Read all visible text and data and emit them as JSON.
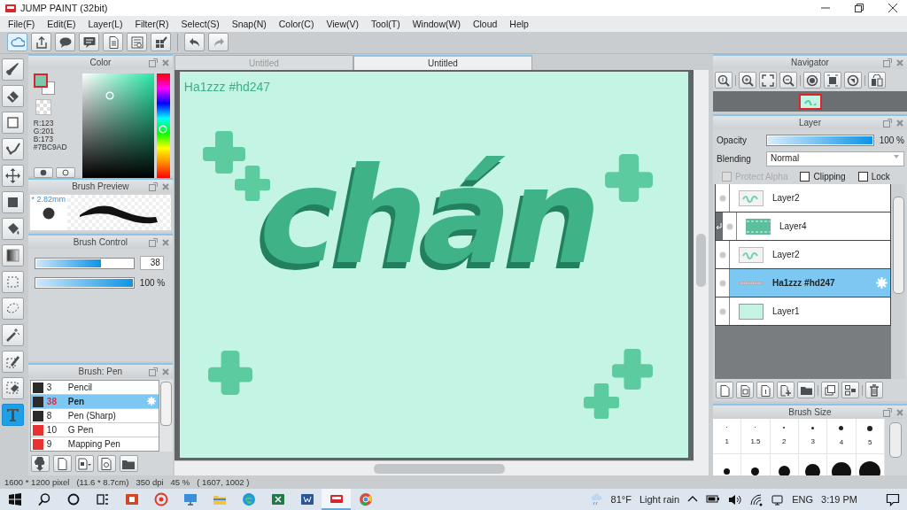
{
  "window": {
    "title": "JUMP PAINT (32bit)"
  },
  "menu": [
    "File(F)",
    "Edit(E)",
    "Layer(L)",
    "Filter(R)",
    "Select(S)",
    "Snap(N)",
    "Color(C)",
    "View(V)",
    "Tool(T)",
    "Window(W)",
    "Cloud",
    "Help"
  ],
  "tools": [
    {
      "kind": "brush",
      "selected": false
    },
    {
      "kind": "eraser",
      "selected": false
    },
    {
      "kind": "shape",
      "selected": false
    },
    {
      "kind": "curve",
      "selected": false
    },
    {
      "kind": "move",
      "selected": false
    },
    {
      "kind": "fill",
      "selected": false
    },
    {
      "kind": "bucket",
      "selected": false
    },
    {
      "kind": "gradient",
      "selected": false
    },
    {
      "kind": "marquee",
      "selected": false
    },
    {
      "kind": "lasso",
      "selected": false
    },
    {
      "kind": "wand",
      "selected": false
    },
    {
      "kind": "select_pen",
      "selected": false
    },
    {
      "kind": "select_eraser",
      "selected": false
    },
    {
      "kind": "text",
      "selected": true
    }
  ],
  "color_panel": {
    "title": "Color",
    "r": "R:123",
    "g": "G:201",
    "b": "B:173",
    "hex": "#7BC9AD"
  },
  "brush_preview": {
    "title": "Brush Preview",
    "size": "* 2.82mm"
  },
  "brush_control": {
    "title": "Brush Control",
    "sliders": [
      {
        "level": 0.67,
        "reading": "38"
      },
      {
        "level": 1.0,
        "reading": "100 %"
      }
    ]
  },
  "brush_list": {
    "title": "Brush: Pen",
    "items": [
      {
        "color": "#2b2b2b",
        "size": "3",
        "name": "Pencil",
        "selected": false
      },
      {
        "color": "#2b2b2b",
        "size": "38",
        "name": "Pen",
        "selected": true
      },
      {
        "color": "#2b2b2b",
        "size": "8",
        "name": "Pen (Sharp)",
        "selected": false
      },
      {
        "color": "#e83232",
        "size": "10",
        "name": "G Pen",
        "selected": false
      },
      {
        "color": "#e83232",
        "size": "9",
        "name": "Mapping Pen",
        "selected": false
      }
    ]
  },
  "canvas": {
    "tabs": [
      {
        "label": "Untitled",
        "selected": false
      },
      {
        "label": "Untitled",
        "selected": true
      }
    ],
    "caption": "Ha1zzz #hd247",
    "lettering": "chán"
  },
  "navigator": {
    "title": "Navigator"
  },
  "layer_panel": {
    "title": "Layer",
    "opacity": {
      "label": "Opacity",
      "level": 1.0,
      "reading": "100 %"
    },
    "blending": {
      "label": "Blending",
      "value": "Normal"
    },
    "options": [
      {
        "label": "Protect Alpha",
        "checked": false,
        "disabled": true
      },
      {
        "label": "Clipping",
        "checked": false,
        "disabled": false
      },
      {
        "label": "Lock",
        "checked": false,
        "disabled": false
      }
    ],
    "layers": [
      {
        "name": "Layer2",
        "kind": "lettering",
        "clipped": false,
        "selected": false
      },
      {
        "name": "Layer4",
        "kind": "fill",
        "clipped": true,
        "selected": false
      },
      {
        "name": "Layer2",
        "kind": "lettering",
        "clipped": false,
        "selected": false
      },
      {
        "name": "Ha1zzz #hd247",
        "kind": "text",
        "clipped": false,
        "selected": true
      },
      {
        "name": "Layer1",
        "kind": "background",
        "clipped": false,
        "selected": false
      }
    ]
  },
  "brush_size": {
    "title": "Brush Size",
    "sizes": [
      "1",
      "1.5",
      "2",
      "3",
      "4",
      "5"
    ]
  },
  "status_bar": {
    "pixels": "1600 * 1200 pixel",
    "physical": "(11.6 * 8.7cm)",
    "dpi": "350 dpi",
    "zoom": "45 %",
    "cursor": "( 1607, 1002 )"
  },
  "taskbar": {
    "apps": [
      {
        "kind": "slides",
        "selected": false
      },
      {
        "kind": "recorder",
        "selected": false
      },
      {
        "kind": "monitor",
        "selected": false
      },
      {
        "kind": "folder",
        "selected": false
      },
      {
        "kind": "browser",
        "selected": false
      },
      {
        "kind": "sheet",
        "selected": false
      },
      {
        "kind": "doc",
        "selected": false
      },
      {
        "kind": "paint",
        "selected": true
      },
      {
        "kind": "chrome",
        "selected": false
      }
    ],
    "temperature": "81°F",
    "weather": "Light rain",
    "language": "ENG",
    "time": "3:19 PM"
  }
}
